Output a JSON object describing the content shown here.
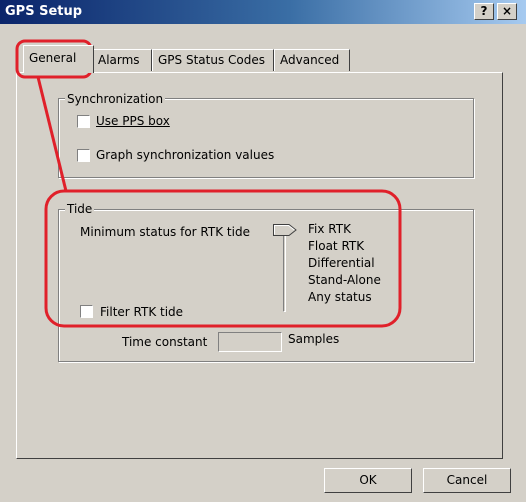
{
  "window": {
    "title": "GPS Setup",
    "help_label": "?",
    "close_label": "×"
  },
  "tabs": [
    {
      "label": "General"
    },
    {
      "label": "Alarms"
    },
    {
      "label": "GPS Status Codes"
    },
    {
      "label": "Advanced"
    }
  ],
  "synchronization": {
    "title": "Synchronization",
    "use_pps_box": "Use PPS box",
    "graph_values": "Graph synchronization values"
  },
  "tide": {
    "title": "Tide",
    "min_status_label": "Minimum status for RTK tide",
    "status_levels": [
      "Fix RTK",
      "Float RTK",
      "Differential",
      "Stand-Alone",
      "Any status"
    ],
    "filter_label": "Filter RTK tide",
    "time_constant_label": "Time constant",
    "time_constant_value": "",
    "samples_label": "Samples"
  },
  "buttons": {
    "ok": "OK",
    "cancel": "Cancel"
  },
  "annotation_color": "#e0202a"
}
